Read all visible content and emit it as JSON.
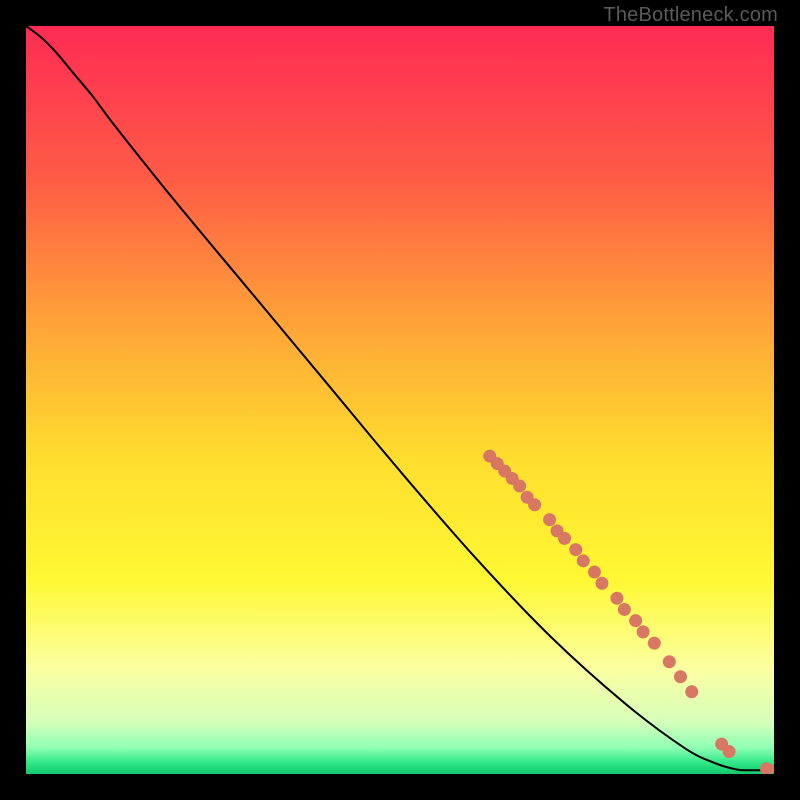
{
  "watermark": "TheBottleneck.com",
  "chart_data": {
    "type": "line",
    "title": "",
    "xlabel": "",
    "ylabel": "",
    "xlim": [
      0,
      100
    ],
    "ylim": [
      0,
      100
    ],
    "grid": false,
    "background_gradient": {
      "stops": [
        {
          "pos": 0.0,
          "color": "#ff2b54"
        },
        {
          "pos": 0.2,
          "color": "#ff5a46"
        },
        {
          "pos": 0.4,
          "color": "#ffa438"
        },
        {
          "pos": 0.58,
          "color": "#ffde2e"
        },
        {
          "pos": 0.74,
          "color": "#fff833"
        },
        {
          "pos": 0.86,
          "color": "#fbffa2"
        },
        {
          "pos": 0.93,
          "color": "#d6ffba"
        },
        {
          "pos": 0.965,
          "color": "#8fffb4"
        },
        {
          "pos": 0.985,
          "color": "#2fe786"
        },
        {
          "pos": 1.0,
          "color": "#12c96c"
        }
      ]
    },
    "curve_points": [
      {
        "x": 0.0,
        "y": 100.0
      },
      {
        "x": 2.0,
        "y": 98.5
      },
      {
        "x": 4.0,
        "y": 96.5
      },
      {
        "x": 6.5,
        "y": 93.5
      },
      {
        "x": 9.0,
        "y": 90.5
      },
      {
        "x": 12.0,
        "y": 86.5
      },
      {
        "x": 20.0,
        "y": 76.5
      },
      {
        "x": 30.0,
        "y": 64.5
      },
      {
        "x": 40.0,
        "y": 52.5
      },
      {
        "x": 50.0,
        "y": 40.5
      },
      {
        "x": 60.0,
        "y": 29.0
      },
      {
        "x": 70.0,
        "y": 18.5
      },
      {
        "x": 80.0,
        "y": 9.5
      },
      {
        "x": 88.0,
        "y": 3.5
      },
      {
        "x": 92.0,
        "y": 1.5
      },
      {
        "x": 95.0,
        "y": 0.6
      },
      {
        "x": 97.0,
        "y": 0.5
      },
      {
        "x": 100.0,
        "y": 0.5
      }
    ],
    "markers": [
      {
        "x": 62.0,
        "y": 42.5
      },
      {
        "x": 63.0,
        "y": 41.5
      },
      {
        "x": 64.0,
        "y": 40.5
      },
      {
        "x": 65.0,
        "y": 39.5
      },
      {
        "x": 66.0,
        "y": 38.5
      },
      {
        "x": 67.0,
        "y": 37.0
      },
      {
        "x": 68.0,
        "y": 36.0
      },
      {
        "x": 70.0,
        "y": 34.0
      },
      {
        "x": 71.0,
        "y": 32.5
      },
      {
        "x": 72.0,
        "y": 31.5
      },
      {
        "x": 73.5,
        "y": 30.0
      },
      {
        "x": 74.5,
        "y": 28.5
      },
      {
        "x": 76.0,
        "y": 27.0
      },
      {
        "x": 77.0,
        "y": 25.5
      },
      {
        "x": 79.0,
        "y": 23.5
      },
      {
        "x": 80.0,
        "y": 22.0
      },
      {
        "x": 81.5,
        "y": 20.5
      },
      {
        "x": 82.5,
        "y": 19.0
      },
      {
        "x": 84.0,
        "y": 17.5
      },
      {
        "x": 86.0,
        "y": 15.0
      },
      {
        "x": 87.5,
        "y": 13.0
      },
      {
        "x": 89.0,
        "y": 11.0
      },
      {
        "x": 93.0,
        "y": 4.0
      },
      {
        "x": 94.0,
        "y": 3.0
      },
      {
        "x": 99.0,
        "y": 0.7
      },
      {
        "x": 100.5,
        "y": 0.7
      }
    ],
    "marker_color": "#d87763",
    "curve_color": "#000000"
  }
}
